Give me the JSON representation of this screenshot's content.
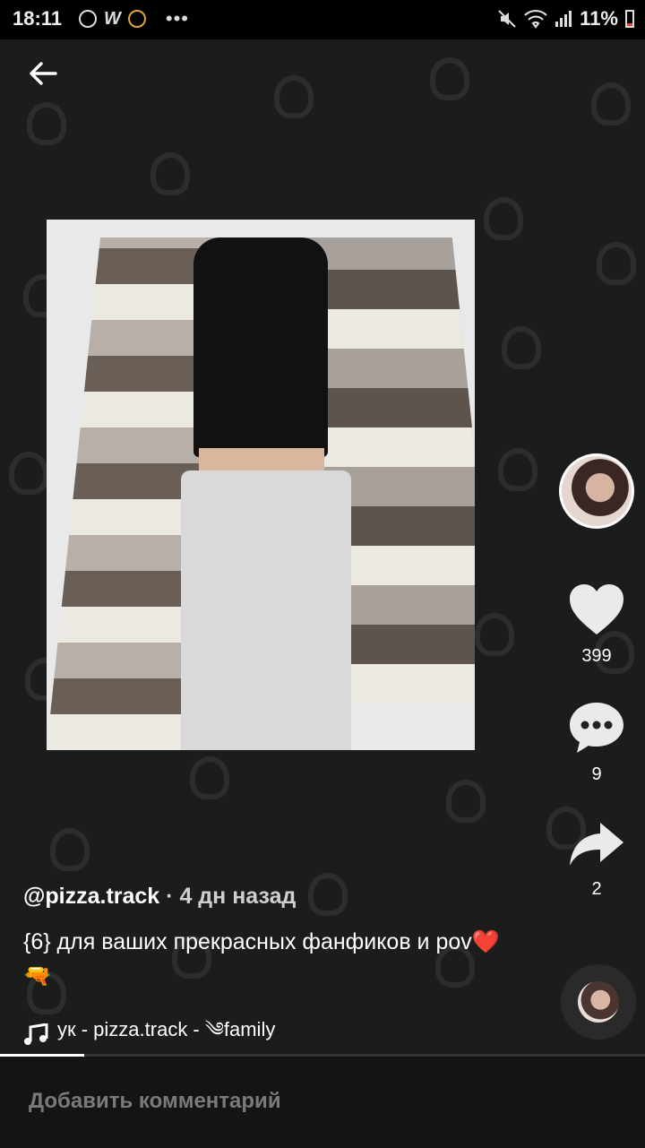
{
  "status_bar": {
    "time": "18:11",
    "battery": "11%"
  },
  "video": {
    "author": "@pizza.track",
    "time_ago": "· 4 дн назад",
    "caption": "{6} для ваших прекрасных фанфиков и pov❤️🔫",
    "music": "ук - pizza.track - ༄family"
  },
  "actions": {
    "likes": "399",
    "comments": "9",
    "shares": "2"
  },
  "progress": 0.13,
  "comment_bar": {
    "placeholder": "Добавить комментарий"
  }
}
